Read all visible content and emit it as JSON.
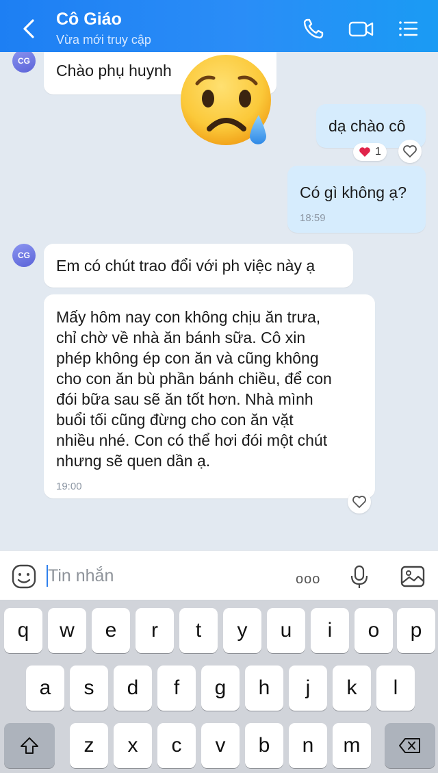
{
  "header": {
    "title": "Cô Giáo",
    "subtitle": "Vừa mới truy cập"
  },
  "messages": {
    "m1": {
      "avatar": "CG",
      "text": "Chào phụ huynh"
    },
    "m2": {
      "text": "dạ chào cô",
      "reaction_count": "1"
    },
    "m3": {
      "text": "Có gì không ạ?",
      "time": "18:59"
    },
    "m4": {
      "avatar": "CG",
      "text": "Em có chút trao đổi với ph việc này ạ"
    },
    "m5": {
      "lines": [
        "Mấy hôm nay con không chịu ăn trưa,",
        "chỉ chờ về nhà ăn bánh sữa. Cô xin",
        "phép không ép con ăn và cũng không",
        "cho con ăn bù phần bánh chiều, để con",
        "đói bữa sau sẽ ăn tốt hơn. Nhà mình",
        "buổi tối cũng đừng cho con ăn vặt",
        "nhiều nhé. Con có thể hơi đói một chút",
        "nhưng sẽ quen dần ạ."
      ],
      "time": "19:00"
    }
  },
  "input": {
    "placeholder": "Tin nhắn",
    "more_label": "ooo"
  },
  "keyboard": {
    "row1": [
      "q",
      "w",
      "e",
      "r",
      "t",
      "y",
      "u",
      "i",
      "o",
      "p"
    ],
    "row2": [
      "a",
      "s",
      "d",
      "f",
      "g",
      "h",
      "j",
      "k",
      "l"
    ],
    "row3": [
      "z",
      "x",
      "c",
      "v",
      "b",
      "n",
      "m"
    ]
  },
  "icons": {
    "back": "chevron-left-icon",
    "call": "phone-icon",
    "video": "video-camera-icon",
    "menu": "list-menu-icon",
    "sticker": "smiley-sticker-icon",
    "voice": "microphone-icon",
    "image": "image-icon",
    "shift": "shift-icon",
    "delete": "backspace-icon",
    "react": "heart-outline-icon",
    "reaction": "red-heart-icon",
    "overlay_emoji": "sad-tear-face-icon"
  },
  "colors": {
    "header": "#1d7ff3",
    "outgoing_bubble": "#d6ecfd",
    "incoming_bubble": "#ffffff",
    "chat_background": "#e2e9f1",
    "avatar": "#6f78e6",
    "reaction_heart": "#e0244a"
  }
}
